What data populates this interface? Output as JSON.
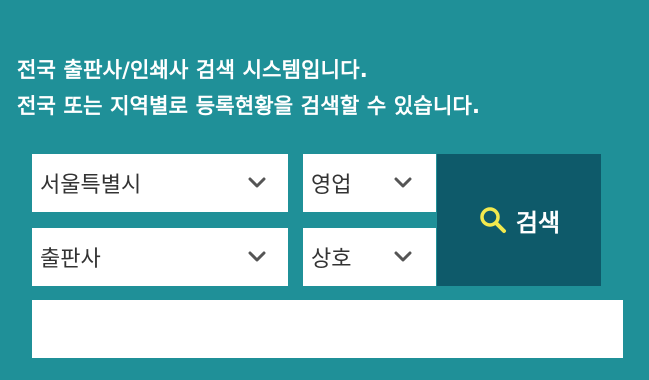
{
  "intro": {
    "line1": "전국 출판사/인쇄사 검색 시스템입니다.",
    "line2": "전국 또는 지역별로 등록현황을 검색할 수 있습니다."
  },
  "filters": {
    "region": "서울특별시",
    "status": "영업",
    "category": "출판사",
    "field": "상호"
  },
  "search": {
    "label": "검색",
    "icon": "search-icon",
    "keyword_value": "",
    "keyword_placeholder": ""
  },
  "colors": {
    "background": "#1f9098",
    "button": "#0e5a6a",
    "icon": "#f2e94e",
    "chevron": "#555555"
  }
}
